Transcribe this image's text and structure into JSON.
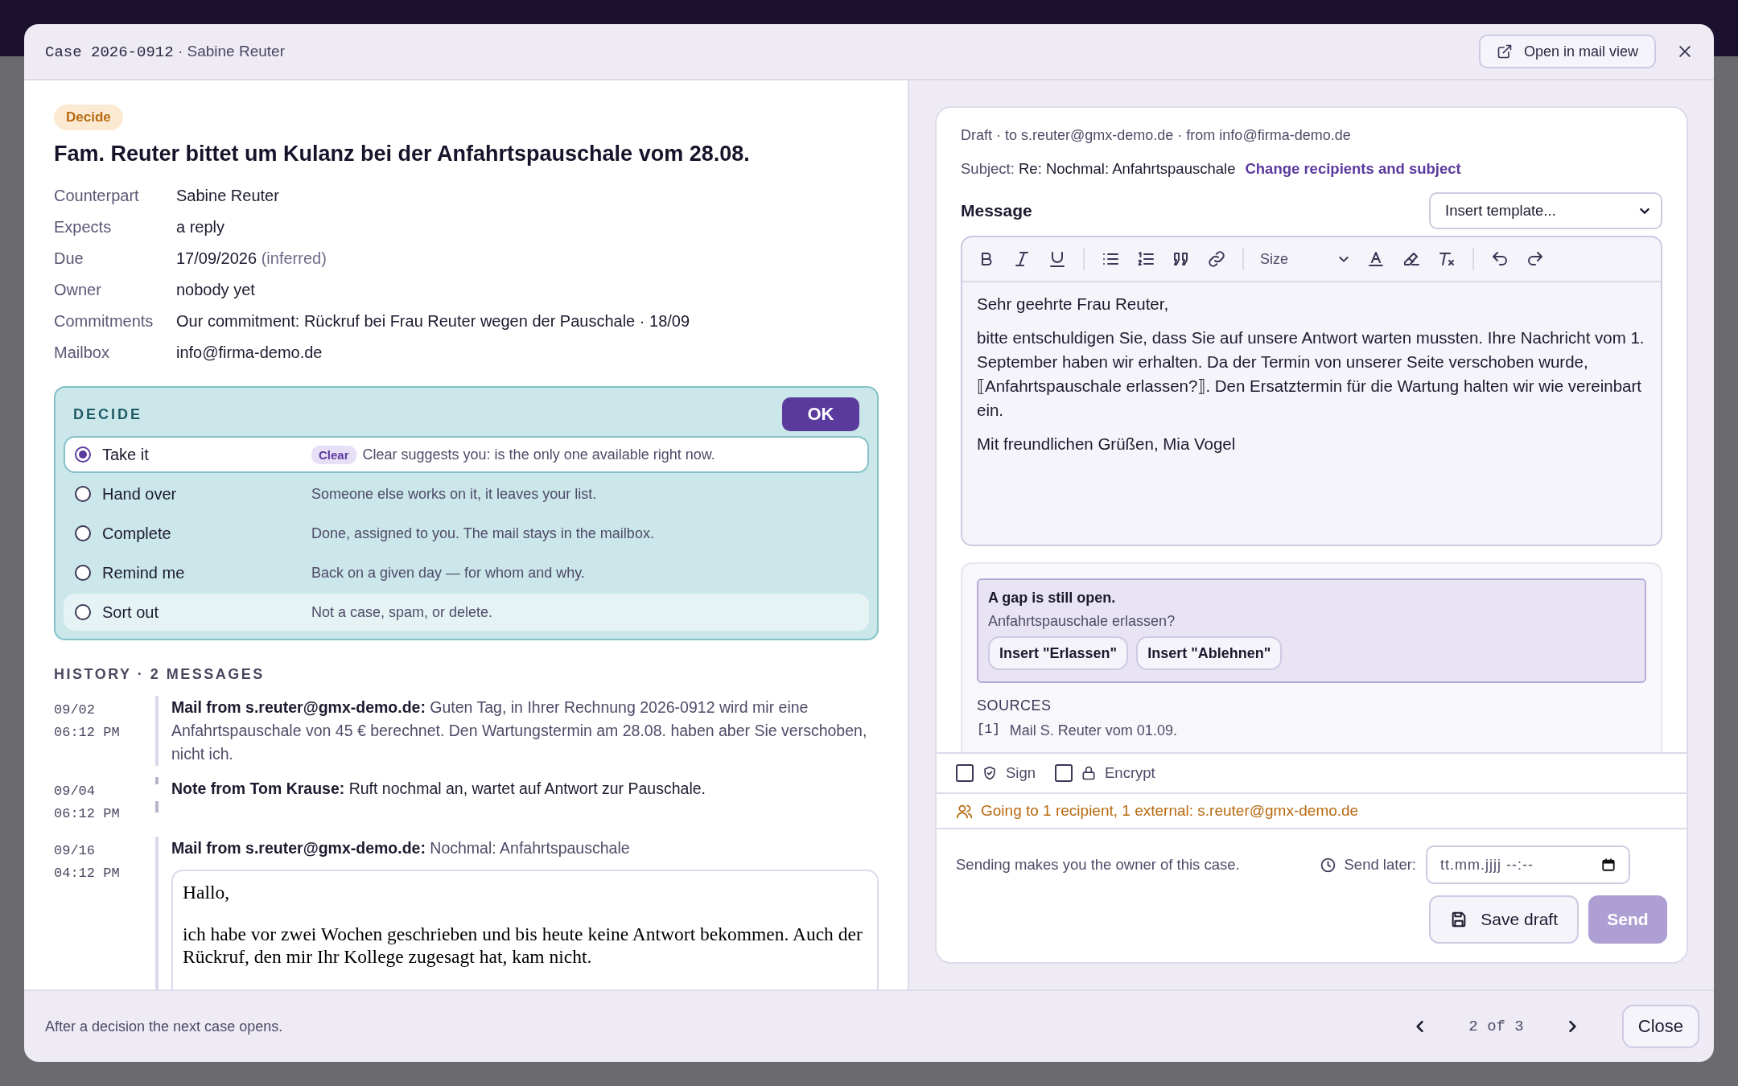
{
  "header": {
    "case_code": "Case 2026-0912",
    "case_name": "· Sabine Reuter",
    "open_button": "Open in mail view"
  },
  "case": {
    "badge": "Decide",
    "title": "Fam. Reuter bittet um Kulanz bei der Anfahrtspauschale vom 28.08.",
    "fields": [
      {
        "label": "Counterpart",
        "value": "Sabine Reuter"
      },
      {
        "label": "Expects",
        "value": "a reply"
      },
      {
        "label": "Due",
        "value": "17/09/2026",
        "note": "(inferred)"
      },
      {
        "label": "Owner",
        "value": "nobody yet"
      },
      {
        "label": "Commitments",
        "value": "Our commitment: Rückruf bei Frau Reuter wegen der Pauschale · 18/09"
      },
      {
        "label": "Mailbox",
        "value": "info@firma-demo.de"
      }
    ]
  },
  "decide": {
    "heading": "DECIDE",
    "ok_button": "OK",
    "options": [
      {
        "label": "Take it",
        "tag": "Clear",
        "hint": "Clear suggests you: is the only one available right now.",
        "selected": true,
        "hovered": false
      },
      {
        "label": "Hand over",
        "hint": "Someone else works on it, it leaves your list.",
        "selected": false,
        "hovered": false
      },
      {
        "label": "Complete",
        "hint": "Done, assigned to you. The mail stays in the mailbox.",
        "selected": false,
        "hovered": false
      },
      {
        "label": "Remind me",
        "hint": "Back on a given day — for whom and why.",
        "selected": false,
        "hovered": false
      },
      {
        "label": "Sort out",
        "hint": "Not a case, spam, or delete.",
        "selected": false,
        "hovered": true
      }
    ]
  },
  "history": {
    "heading": "HISTORY · 2 MESSAGES",
    "entries": [
      {
        "kind": "mail",
        "date": "09/02",
        "time": "06:12 PM",
        "sender": "Mail from s.reuter@gmx-demo.de:",
        "text": "Guten Tag, in Ihrer Rechnung 2026-0912 wird mir eine Anfahrtspauschale von 45 € berechnet. Den Wartungstermin am 28.08. haben aber Sie verschoben, nicht ich."
      },
      {
        "kind": "note",
        "date": "09/04",
        "time": "06:12 PM",
        "sender": "Note from Tom Krause:",
        "text": "Ruft nochmal an, wartet auf Antwort zur Pauschale."
      },
      {
        "kind": "mail",
        "date": "09/16",
        "time": "04:12 PM",
        "sender": "Mail from s.reuter@gmx-demo.de:",
        "text": "Nochmal: Anfahrtspauschale",
        "body": [
          "Hallo,",
          "ich habe vor zwei Wochen geschrieben und bis heute keine Antwort bekommen. Auch der Rückruf, den mir Ihr Kollege zugesagt hat, kam nicht."
        ]
      }
    ]
  },
  "draft": {
    "meta": "Draft · to s.reuter@gmx-demo.de · from info@firma-demo.de",
    "subject_label": "Subject:",
    "subject": "Re: Nochmal: Anfahrtspauschale",
    "change_link": "Change recipients and subject",
    "message_label": "Message",
    "template_placeholder": "Insert template...",
    "size_label": "Size",
    "paragraphs": [
      "Sehr geehrte Frau Reuter,",
      "bitte entschuldigen Sie, dass Sie auf unsere Antwort warten mussten. Ihre Nachricht vom 1. September haben wir erhalten. Da der Termin von unserer Seite verschoben wurde, ⟦Anfahrtspauschale erlassen?⟧. Den Ersatztermin für die Wartung halten wir wie vereinbart ein.",
      "Mit freundlichen Grüßen, Mia Vogel"
    ],
    "gap": {
      "title": "A gap is still open.",
      "question": "Anfahrtspauschale erlassen?",
      "buttons": [
        "Insert \"Erlassen\"",
        "Insert \"Ablehnen\""
      ]
    },
    "sources": {
      "heading": "SOURCES",
      "items": [
        {
          "index": "[1]",
          "text": "Mail S. Reuter vom 01.09."
        }
      ]
    },
    "options": [
      {
        "kind": "sign",
        "label": "Sign",
        "checked": false
      },
      {
        "kind": "encrypt",
        "label": "Encrypt",
        "checked": false
      }
    ],
    "recipients_warning": "Going to 1 recipient, 1 external: s.reuter@gmx-demo.de",
    "owner_note": "Sending makes you the owner of this case.",
    "send_later_label": "Send later:",
    "date_placeholder": "tt.mm.jjjj --:--",
    "save_button": "Save draft",
    "send_button": "Send",
    "send_disabled": true
  },
  "footer": {
    "note": "After a decision the next case opens.",
    "pager": "2 of 3",
    "close_button": "Close"
  }
}
